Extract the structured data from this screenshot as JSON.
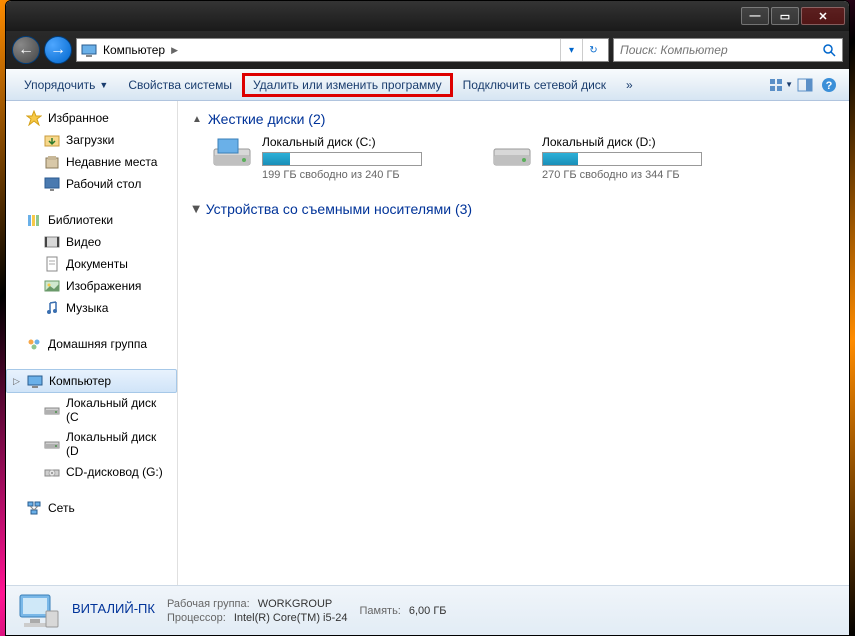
{
  "titlebar": {
    "min": "—",
    "max": "▭",
    "close": "✕"
  },
  "nav": {
    "back": "←",
    "fwd": "→"
  },
  "address": {
    "root_icon": "💻",
    "crumb": "Компьютер",
    "sep": "▶"
  },
  "search": {
    "placeholder": "Поиск: Компьютер"
  },
  "toolbar": {
    "organize": "Упорядочить",
    "sysprops": "Свойства системы",
    "uninstall": "Удалить или изменить программу",
    "mapdrive": "Подключить сетевой диск",
    "more": "»"
  },
  "sidebar": {
    "favorites": {
      "label": "Избранное",
      "items": [
        {
          "icon": "folder-down-icon",
          "label": "Загрузки"
        },
        {
          "icon": "recent-icon",
          "label": "Недавние места"
        },
        {
          "icon": "desktop-icon",
          "label": "Рабочий стол"
        }
      ]
    },
    "libraries": {
      "label": "Библиотеки",
      "items": [
        {
          "icon": "video-icon",
          "label": "Видео"
        },
        {
          "icon": "document-icon",
          "label": "Документы"
        },
        {
          "icon": "image-icon",
          "label": "Изображения"
        },
        {
          "icon": "music-icon",
          "label": "Музыка"
        }
      ]
    },
    "homegroup": {
      "label": "Домашняя группа"
    },
    "computer": {
      "label": "Компьютер",
      "items": [
        {
          "icon": "drive-icon",
          "label": "Локальный диск (C"
        },
        {
          "icon": "drive-icon",
          "label": "Локальный диск (D"
        },
        {
          "icon": "cd-icon",
          "label": "CD-дисковод (G:)"
        }
      ]
    },
    "network": {
      "label": "Сеть"
    }
  },
  "main": {
    "hdd_section": "Жесткие диски (2)",
    "removable_section": "Устройства со съемными носителями (3)",
    "drives": [
      {
        "name": "Локальный диск (C:)",
        "free_text": "199 ГБ свободно из 240 ГБ",
        "used_pct": 17
      },
      {
        "name": "Локальный диск (D:)",
        "free_text": "270 ГБ свободно из 344 ГБ",
        "used_pct": 22
      }
    ]
  },
  "details": {
    "name": "ВИТАЛИЙ-ПК",
    "workgroup_lbl": "Рабочая группа:",
    "workgroup_val": "WORKGROUP",
    "memory_lbl": "Память:",
    "memory_val": "6,00 ГБ",
    "cpu_lbl": "Процессор:",
    "cpu_val": "Intel(R) Core(TM) i5-24"
  }
}
